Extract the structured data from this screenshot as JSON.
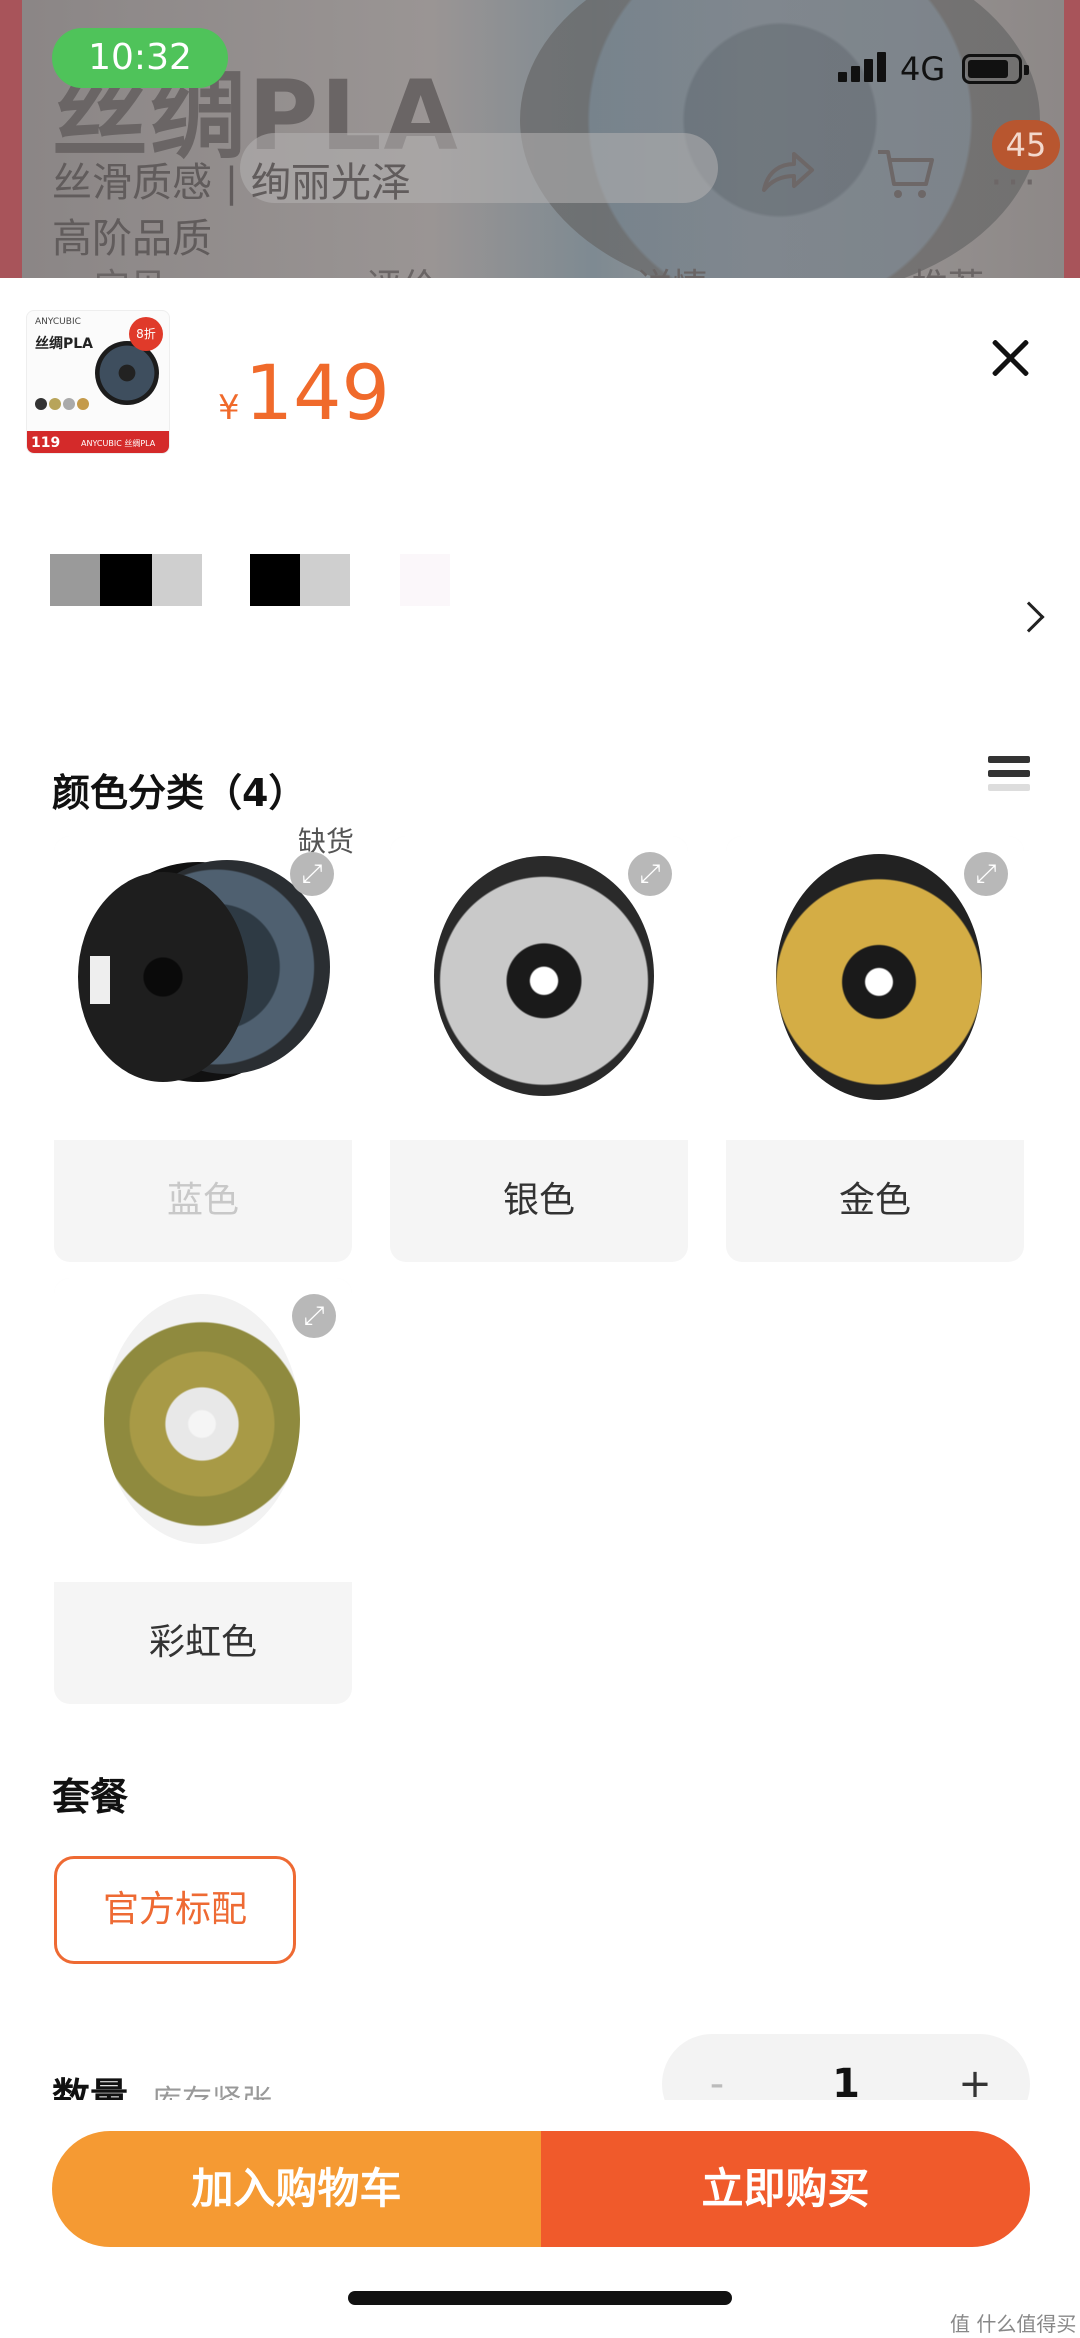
{
  "status_bar": {
    "time": "10:32",
    "network": "4G"
  },
  "background_page": {
    "title": "丝绸PLA",
    "subtitle_line1": "丝滑质感 | 绚丽光泽",
    "subtitle_line2": "高阶品质",
    "cart_badge": "45",
    "tabs": [
      "宝贝",
      "评价",
      "详情",
      "推荐"
    ]
  },
  "sheet": {
    "thumbnail": {
      "brand": "ANYCUBIC",
      "title": "丝绸PLA",
      "tag": "8折",
      "price": "119",
      "footer": "ANYCUBIC 丝绸PLA"
    },
    "price": {
      "currency": "¥",
      "value": "149"
    },
    "color_section": {
      "title": "颜色分类（4）",
      "options": [
        {
          "label": "蓝色",
          "status": "缺货",
          "disabled": true
        },
        {
          "label": "银色",
          "status": "",
          "disabled": false
        },
        {
          "label": "金色",
          "status": "",
          "disabled": false
        },
        {
          "label": "彩虹色",
          "status": "",
          "disabled": false
        }
      ]
    },
    "package_section": {
      "title": "套餐",
      "options": [
        "官方标配"
      ]
    },
    "quantity": {
      "label": "数量",
      "stock_tip": "库存紧张",
      "value": "1",
      "minus": "-",
      "plus": "+"
    },
    "actions": {
      "add_to_cart": "加入购物车",
      "buy_now": "立即购买"
    }
  },
  "colors": {
    "accent": "#f06a2b",
    "cart_button": "#f59a33",
    "buy_button": "#f05a2b",
    "time_pill": "#4fc35a"
  },
  "watermark": "值 什么值得买"
}
